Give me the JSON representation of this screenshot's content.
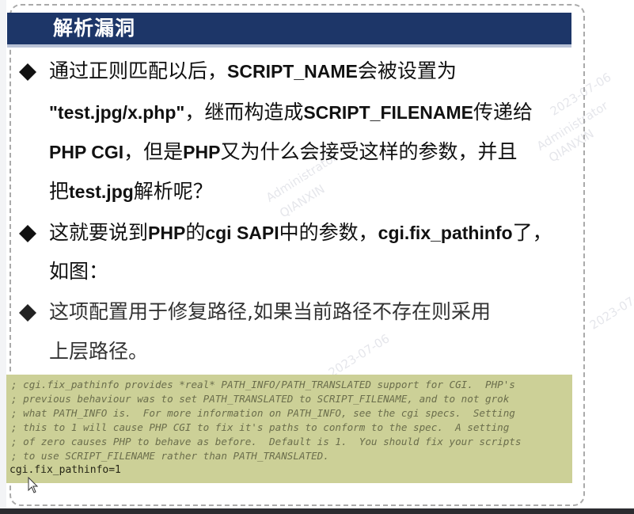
{
  "title": "解析漏洞",
  "bullets": [
    {
      "lines": [
        [
          "通过正则匹配以后，",
          "SCRIPT_NAME",
          "会被设置为"
        ],
        [
          "\"test.jpg/x.php\"",
          "，继而构造成",
          "SCRIPT_FILENAME",
          "传递给"
        ],
        [
          "PHP CGI",
          "，但是",
          "PHP",
          "又为什么会接受这样的参数，并且"
        ],
        [
          "把",
          "test.jpg",
          "解析呢？"
        ]
      ]
    },
    {
      "lines": [
        [
          "这就要说到",
          "PHP",
          "的",
          "cgi SAPI",
          "中的参数，",
          "cgi.fix_pathinfo",
          "了，"
        ],
        [
          "如图："
        ]
      ]
    },
    {
      "lines": [
        [
          "这项配置用于修复路径,如果当前路径不存在则采用"
        ],
        [
          "上层路径。"
        ]
      ]
    }
  ],
  "code": {
    "comments": [
      "; cgi.fix_pathinfo provides *real* PATH_INFO/PATH_TRANSLATED support for CGI.  PHP's",
      "; previous behaviour was to set PATH_TRANSLATED to SCRIPT_FILENAME, and to not grok",
      "; what PATH_INFO is.  For more information on PATH_INFO, see the cgi specs.  Setting",
      "; this to 1 will cause PHP CGI to fix it's paths to conform to the spec.  A setting",
      "; of zero causes PHP to behave as before.  Default is 1.  You should fix your scripts",
      "; to use SCRIPT_FILENAME rather than PATH_TRANSLATED."
    ],
    "setting": "cgi.fix_pathinfo=1"
  },
  "watermarks": [
    "2023-07-06",
    "Administrator",
    "QIANXIN"
  ],
  "colors": {
    "title_bar": "#1d3668",
    "code_background": "#ccd097",
    "bullet": "#111111"
  },
  "icons": {
    "bullet": "diamond-bullet-icon",
    "cursor": "mouse-pointer-icon"
  }
}
